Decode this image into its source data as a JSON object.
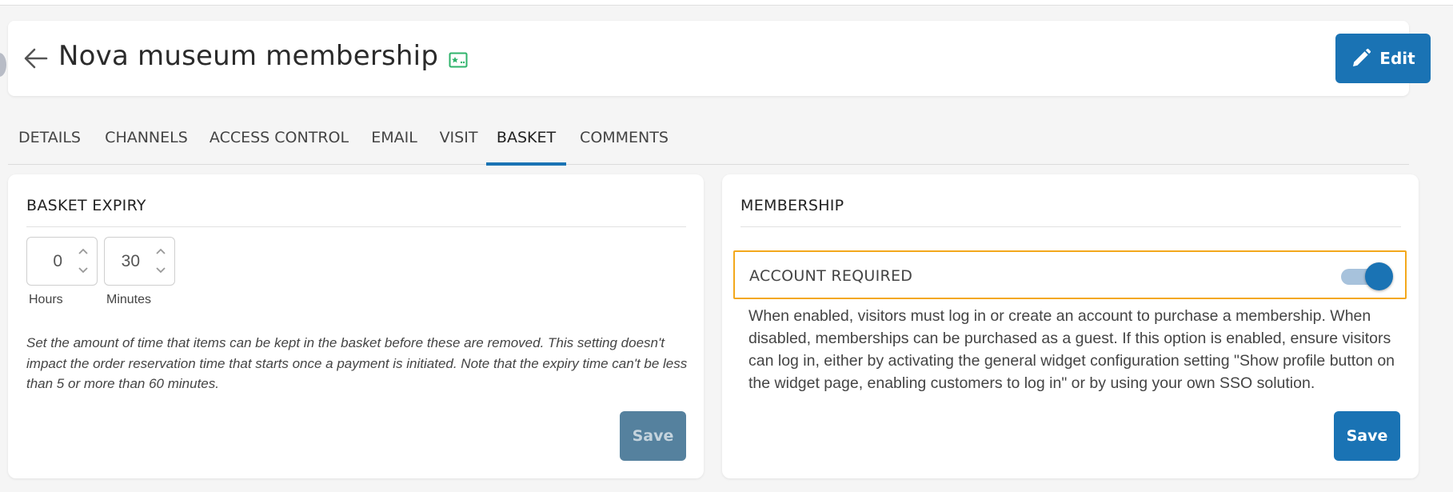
{
  "header": {
    "title": "Nova museum membership",
    "edit_label": "Edit",
    "icons": {
      "back": "arrow-left-icon",
      "title_badge": "image-star-icon",
      "edit": "pencil-icon"
    }
  },
  "tabs": [
    {
      "label": "DETAILS",
      "active": false
    },
    {
      "label": "CHANNELS",
      "active": false
    },
    {
      "label": "ACCESS CONTROL",
      "active": false
    },
    {
      "label": "EMAIL",
      "active": false
    },
    {
      "label": "VISIT",
      "active": false
    },
    {
      "label": "BASKET",
      "active": true
    },
    {
      "label": "COMMENTS",
      "active": false
    }
  ],
  "basket_expiry": {
    "title": "BASKET EXPIRY",
    "hours_value": "0",
    "hours_label": "Hours",
    "minutes_value": "30",
    "minutes_label": "Minutes",
    "help_text": "Set the amount of time that items can be kept in the basket before these are removed. This setting doesn't impact the order reservation time that starts once a payment is initiated. Note that the expiry time can't be less than 5 or more than 60 minutes.",
    "save_label": "Save",
    "save_disabled": true
  },
  "membership": {
    "title": "MEMBERSHIP",
    "account_required_label": "ACCOUNT REQUIRED",
    "account_required_on": true,
    "description": "When enabled, visitors must log in or create an account to purchase a membership. When disabled, memberships can be purchased as a guest. If this option is enabled, ensure visitors can log in, either by activating the general widget configuration setting \"Show profile button on the widget page, enabling customers to log in\" or by using your own SSO solution.",
    "save_label": "Save"
  },
  "colors": {
    "accent": "#1a73b4",
    "highlight_border": "#f3a81c",
    "disabled_button": "#55819e",
    "title_badge": "#2fb36b"
  }
}
